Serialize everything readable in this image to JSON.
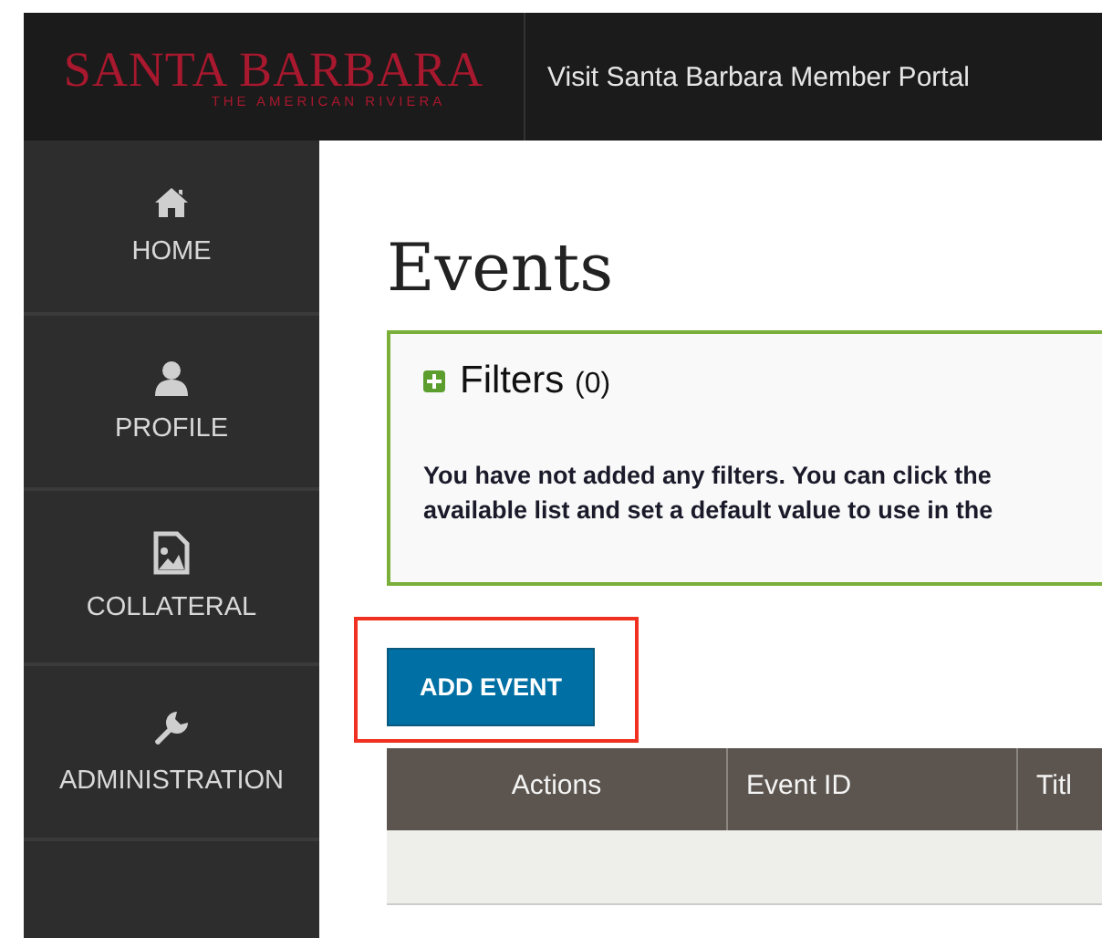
{
  "header": {
    "logo_title": "SANTA BARBARA",
    "logo_tagline": "THE AMERICAN RIVIERA",
    "portal_title": "Visit Santa Barbara Member Portal"
  },
  "sidebar": {
    "items": [
      {
        "label": "HOME"
      },
      {
        "label": "PROFILE"
      },
      {
        "label": "COLLATERAL"
      },
      {
        "label": "ADMINISTRATION"
      }
    ]
  },
  "page_title": "Events",
  "filters": {
    "title": "Filters",
    "count": "(0)",
    "expanded": false,
    "message_lines": [
      "You have not added any filters. You can click the",
      "available list and set a default value to use in the"
    ]
  },
  "add_button": {
    "label": "ADD EVENT",
    "highlighted": true
  },
  "table": {
    "columns": [
      "Actions",
      "Event ID",
      "Titl"
    ]
  }
}
